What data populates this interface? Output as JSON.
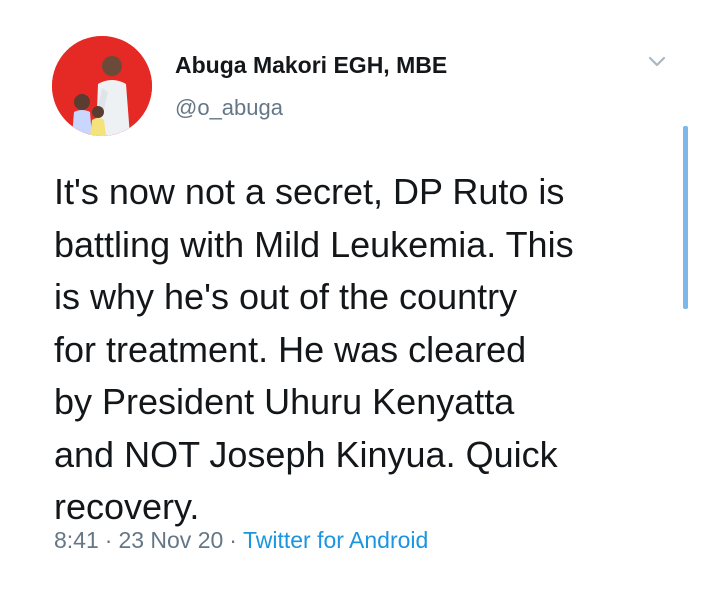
{
  "author": {
    "display_name": "Abuga Makori EGH, MBE",
    "handle": "@o_abuga",
    "avatar_icon": "profile-photo",
    "avatar_bg": "#e52a25"
  },
  "tweet": {
    "lines": [
      "It's now not a secret, DP Ruto is",
      "battling with Mild Leukemia. This",
      "is why he's out of the country",
      "for treatment. He was cleared",
      "by President Uhuru Kenyatta",
      "and NOT Joseph Kinyua. Quick",
      "recovery."
    ]
  },
  "meta": {
    "time": "8:41",
    "separator": "·",
    "date": "23 Nov 20",
    "source": "Twitter for Android"
  },
  "menu_icon": "chevron-down-icon",
  "colors": {
    "text": "#14171a",
    "muted": "#657786",
    "link": "#1b95e0",
    "scroll_indicator": "#7db8e8"
  }
}
